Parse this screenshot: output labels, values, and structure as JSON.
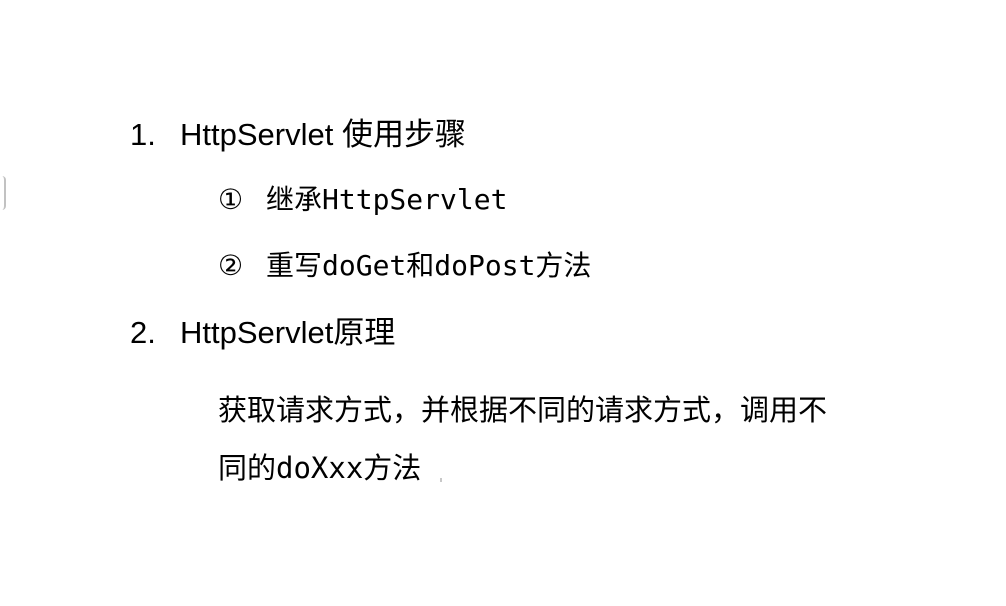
{
  "slide": {
    "items": [
      {
        "number": "1.",
        "title": "HttpServlet 使用步骤",
        "steps": [
          {
            "marker": "①",
            "text": "继承HttpServlet"
          },
          {
            "marker": "②",
            "text": "重写doGet和doPost方法"
          }
        ]
      },
      {
        "number": "2.",
        "title": "HttpServlet原理",
        "description_lines": [
          "获取请求方式，并根据不同的请求方式，调用不",
          "同的doXxx方法"
        ]
      }
    ]
  }
}
